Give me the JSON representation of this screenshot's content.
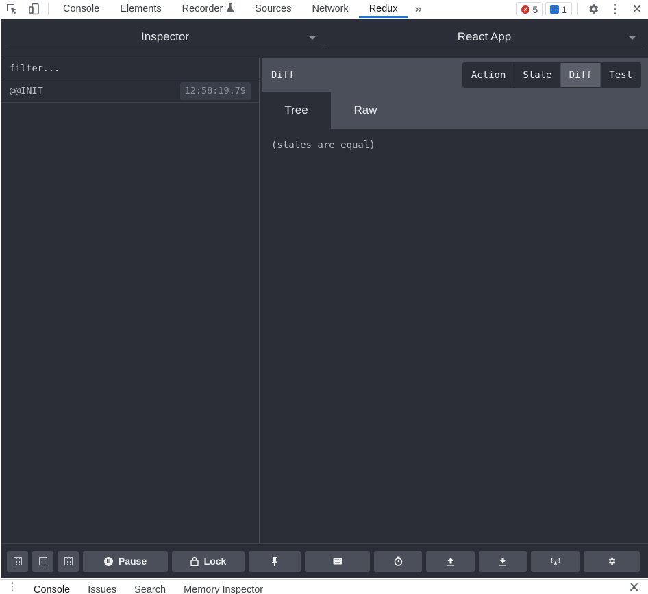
{
  "devtools": {
    "tabs": [
      {
        "label": "Console"
      },
      {
        "label": "Elements"
      },
      {
        "label": "Recorder"
      },
      {
        "label": "Sources"
      },
      {
        "label": "Network"
      },
      {
        "label": "Redux"
      }
    ],
    "active_tab": "Redux",
    "error_count": "5",
    "message_count": "1",
    "icons": [
      "inspect-element-icon",
      "device-toolbar-icon",
      "flask-icon",
      "more-tabs-icon",
      "settings-icon",
      "kebab-menu-icon",
      "close-icon"
    ]
  },
  "redux": {
    "monitor_select": "Inspector",
    "instance_select": "React App",
    "filter_placeholder": "filter...",
    "actions": [
      {
        "name": "@@INIT",
        "time": "12:58:19.79"
      }
    ],
    "pane_title": "Diff",
    "view_buttons": [
      "Action",
      "State",
      "Diff",
      "Test"
    ],
    "active_view": "Diff",
    "sub_tabs": [
      "Tree",
      "Raw"
    ],
    "active_sub_tab": "Tree",
    "diff_message": "(states are equal)",
    "toolbar": {
      "pause_label": "Pause",
      "lock_label": "Lock"
    }
  },
  "drawer": {
    "tabs": [
      "Console",
      "Issues",
      "Search",
      "Memory Inspector"
    ],
    "active_tab": "Console"
  },
  "colors": {
    "panel_bg": "#2b2e36",
    "header_bg": "#4b4f59",
    "active_tab_underline": "#1a73e8",
    "error_red": "#d93025"
  }
}
